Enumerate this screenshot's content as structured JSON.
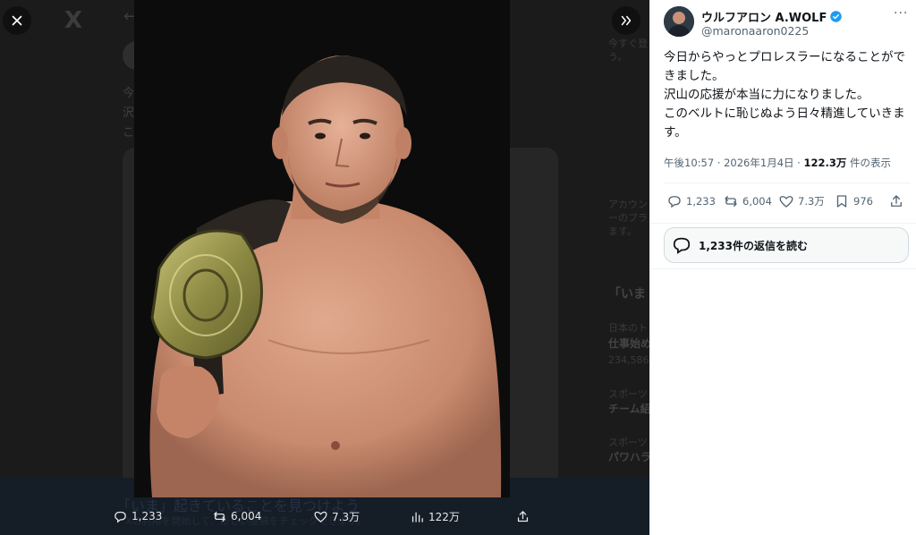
{
  "viewer": {
    "close_label": "✕",
    "collapse_label": "»"
  },
  "background": {
    "logo": "X",
    "tweet_lines": [
      "今",
      "沢",
      "こ"
    ],
    "right_texts": [
      "今すぐ登",
      "う。",
      "アカウン",
      "ーのプラ",
      "ます。",
      "「いま",
      "日本のト",
      "仕事始め",
      "234,586",
      "スポーツ",
      "チーム紹",
      "スポーツ",
      "パワハラ"
    ],
    "banner_text": "「いま」起きていることを見つけよう",
    "banner_sub": "Xの利用を開始して、新しい投稿をチェックできます。"
  },
  "media_actions": {
    "replies": "1,233",
    "reposts": "6,004",
    "likes": "7.3万",
    "views": "122万"
  },
  "tweet": {
    "author_name": "ウルフアロン A.WOLF",
    "handle": "@maronaaron0225",
    "more": "···",
    "body_lines": [
      "今日からやっとプロレスラーになることがで",
      "きました。",
      "沢山の応援が本当に力になりました。",
      "このベルトに恥じぬよう日々精進していきま",
      "す。"
    ],
    "meta_time": "午後10:57 · 2026年1月4日 · ",
    "meta_views_count": "122.3万",
    "meta_views_label": " 件の表示",
    "actions": {
      "replies": "1,233",
      "reposts": "6,004",
      "likes": "7.3万",
      "bookmarks": "976"
    },
    "read_replies": "1,233件の返信を読む"
  },
  "colors": {
    "verified": "#1d9bf0",
    "text_primary": "#0f1419",
    "text_secondary": "#536471"
  }
}
